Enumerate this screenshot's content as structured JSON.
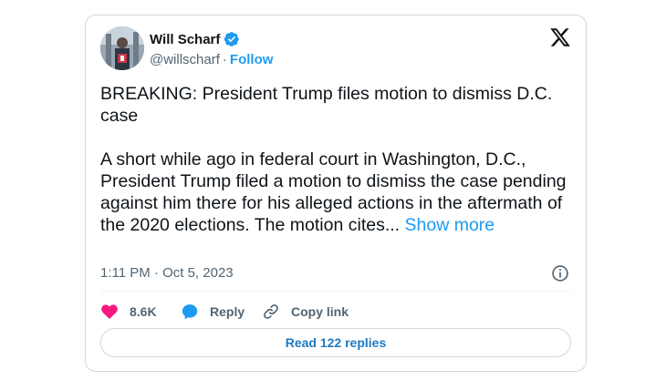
{
  "author": {
    "display_name": "Will Scharf",
    "handle": "@willscharf",
    "separator": "·",
    "follow_label": "Follow"
  },
  "tweet": {
    "paragraph_1": "BREAKING: President Trump files motion to dismiss D.C. case",
    "paragraph_2": "A short while ago in federal court in Washington, D.C., President Trump filed a motion to dismiss the case pending against him there for his alleged actions in the aftermath of the 2020 elections.  The motion cites...",
    "show_more_label": "Show more",
    "timestamp": "1:11 PM · Oct 5, 2023"
  },
  "actions": {
    "like_count": "8.6K",
    "reply_label": "Reply",
    "copy_link_label": "Copy link"
  },
  "read_replies_label": "Read 122 replies",
  "colors": {
    "accent": "#1d9bf0",
    "like": "#f91880",
    "muted_text": "#536471",
    "border": "#cfd9de"
  },
  "icons": {
    "verified": "verified-badge-icon",
    "x_logo": "x-logo-icon",
    "info": "info-icon",
    "like": "heart-icon",
    "reply": "speech-bubble-icon",
    "copy": "link-icon"
  }
}
